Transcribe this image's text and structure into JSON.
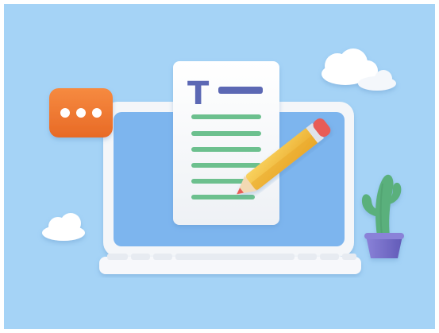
{
  "illustration": {
    "doc_heading_letter": "T",
    "colors": {
      "background": "#a5d3f6",
      "screen": "#7db5ee",
      "laptop_frame": "#f4f6f9",
      "document": "#f7f8fa",
      "text_lines": "#6cc08e",
      "heading_accent": "#5b68b4",
      "chat_bubble": "#f07a32",
      "pencil_body": "#f4c23f",
      "pencil_tip": "#e85b57",
      "cactus": "#5ab07c",
      "pot": "#7b74cc",
      "cloud": "#ffffff"
    },
    "icons": [
      "chat-bubble-icon",
      "document-icon",
      "pencil-icon",
      "laptop-icon",
      "cactus-icon",
      "cloud-icon"
    ]
  }
}
